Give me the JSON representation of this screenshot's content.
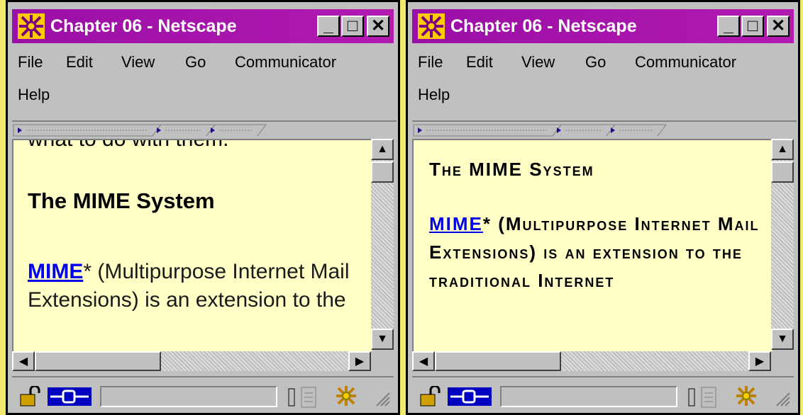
{
  "windows": [
    {
      "title": "Chapter 06 - Netscape",
      "menu": {
        "file": "File",
        "edit": "Edit",
        "view": "View",
        "go": "Go",
        "communicator": "Communicator",
        "help": "Help"
      },
      "content": {
        "fragment": "what to do with them.",
        "heading": "The MIME System",
        "link": "MIME",
        "para": "* (Multipurpose Internet Mail Extensions) is an extension to the"
      }
    },
    {
      "title": "Chapter 06 - Netscape",
      "menu": {
        "file": "File",
        "edit": "Edit",
        "view": "View",
        "go": "Go",
        "communicator": "Communicator",
        "help": "Help"
      },
      "content": {
        "heading": "The MIME System",
        "link": "MIME",
        "para": "* (Multipurpose Internet Mail Extensions) is an extension to the traditional Internet"
      }
    }
  ],
  "colors": {
    "titlebar": "#9a0fa6",
    "content_bg": "#ffffc6",
    "desktop": "#f2ea6a",
    "link": "#0000ee"
  },
  "icons": [
    "netscape-logo-icon",
    "minimize-icon",
    "maximize-icon",
    "close-icon",
    "scroll-up-icon",
    "scroll-down-icon",
    "scroll-left-icon",
    "scroll-right-icon",
    "security-lock-icon",
    "connection-icon",
    "component-bar-icon"
  ]
}
